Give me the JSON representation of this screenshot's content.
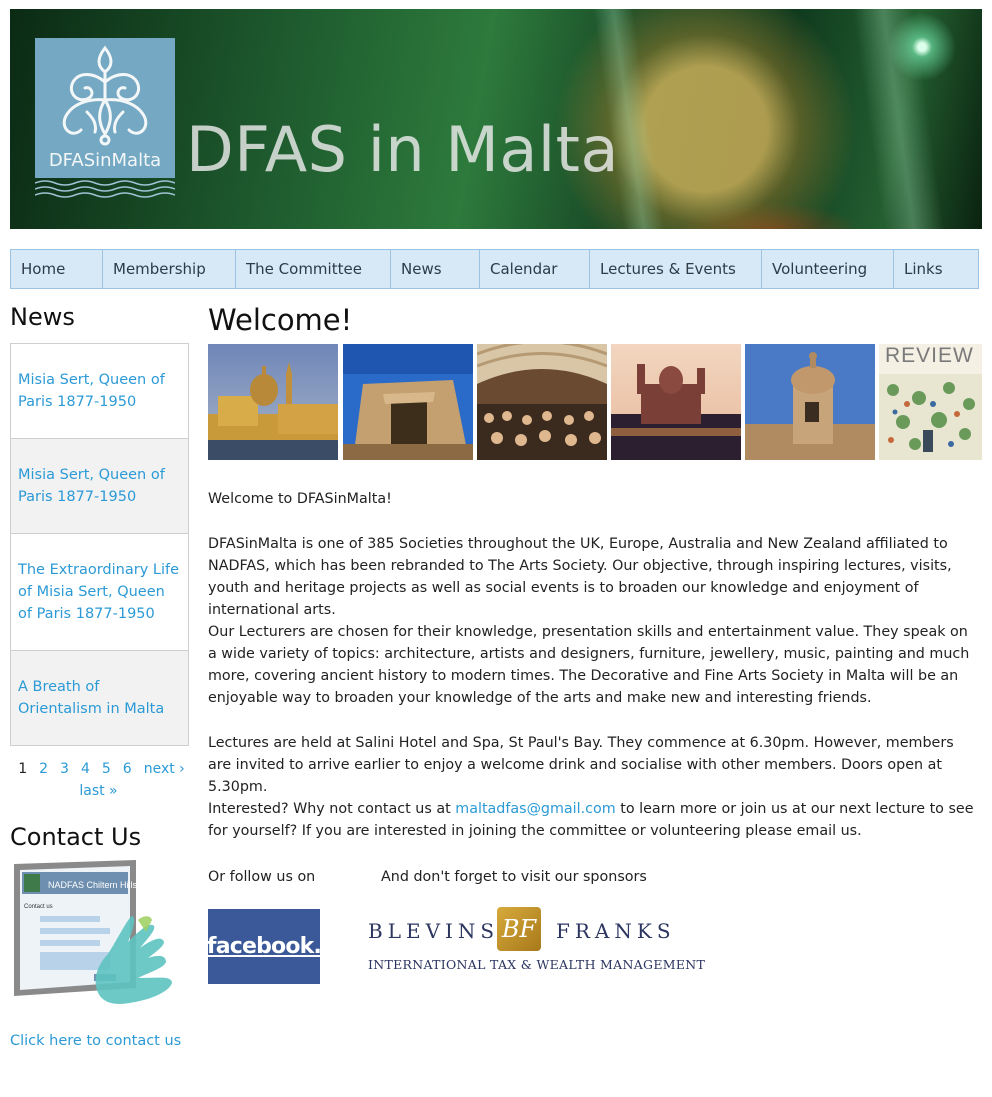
{
  "banner": {
    "logo_text": "DFASinMalta",
    "site_title": "DFAS in Malta"
  },
  "nav": {
    "items": [
      "Home",
      "Membership",
      "The Committee",
      "News",
      "Calendar",
      "Lectures & Events",
      "Volunteering",
      "Links"
    ]
  },
  "sidebar": {
    "news_heading": "News",
    "news_items": [
      "Misia Sert, Queen of Paris 1877-1950",
      "Misia Sert, Queen of Paris 1877-1950",
      "The Extraordinary Life of Misia Sert, Queen of Paris 1877-1950",
      "A Breath of Orientalism in Malta"
    ],
    "pager": {
      "pages": [
        "1",
        "2",
        "3",
        "4",
        "5",
        "6"
      ],
      "current": "1",
      "next_label": "next ›",
      "last_label": "last »"
    },
    "contact_heading": "Contact Us",
    "contact_image_label": "NADFAS Chiltern Hills",
    "contact_link": "Click here to contact us"
  },
  "main": {
    "title": "Welcome!",
    "gallery_review_label": "REVIEW",
    "paragraphs": {
      "p1": "Welcome to DFASinMalta!",
      "p2": "DFASinMalta is one of 385 Societies throughout the UK, Europe, Australia and New Zealand affiliated to NADFAS, which has been rebranded to The Arts Society. Our objective, through inspiring lectures, visits, youth and heritage projects as well as social events is to broaden our knowledge and enjoyment of international arts.",
      "p3": "Our Lecturers are chosen for their knowledge, presentation skills and entertainment value. They speak on a wide variety of topics: architecture, artists and designers, furniture, jewellery, music, painting and much more, covering ancient history to modern times. The Decorative and Fine Arts Society in Malta will be an enjoyable way to broaden your knowledge of the arts and make new and interesting friends.",
      "p4": "Lectures are held at Salini Hotel and Spa, St Paul's Bay. They commence at 6.30pm. However, members are invited to arrive earlier to enjoy a welcome drink and socialise with other members. Doors open at 5.30pm.",
      "p5_before": "Interested? Why not contact us at ",
      "p5_email": "maltadfas@gmail.com",
      "p5_after": " to learn more or join us at our next lecture to see for yourself? If you are interested in joining the committee or volunteering please email us."
    },
    "follow_text": "Or follow us on",
    "sponsor_text": "And don't forget to visit our sponsors",
    "facebook_label": "facebook.",
    "sponsor": {
      "word1": "BLEVINS",
      "monogram": "BF",
      "word2": "FRANKS",
      "tagline": "INTERNATIONAL TAX & WEALTH MANAGEMENT"
    }
  }
}
